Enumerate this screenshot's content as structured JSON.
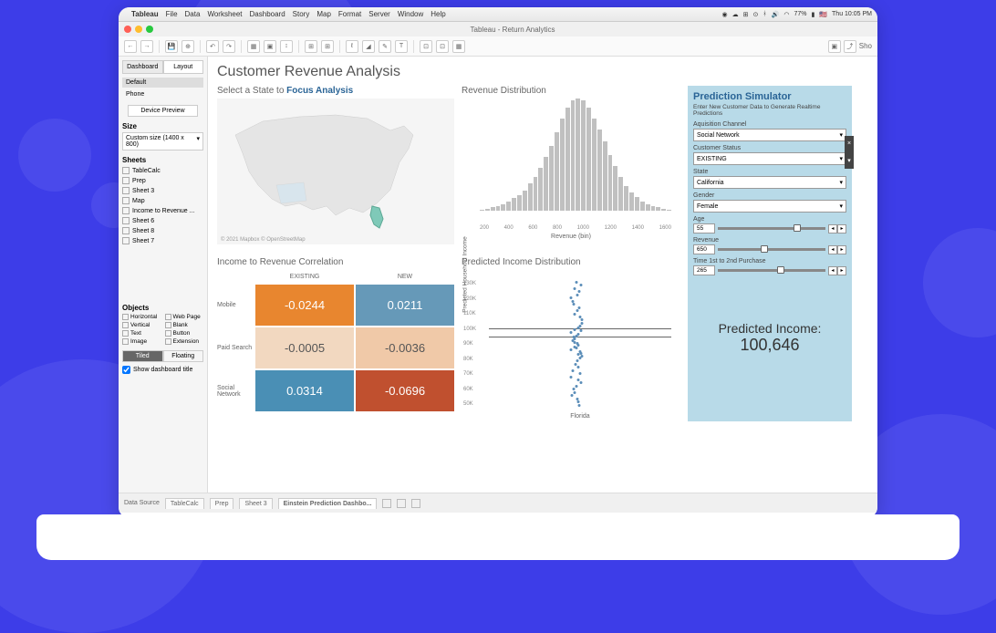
{
  "menubar": {
    "app": "Tableau",
    "items": [
      "File",
      "Data",
      "Worksheet",
      "Dashboard",
      "Story",
      "Map",
      "Format",
      "Server",
      "Window",
      "Help"
    ],
    "battery": "77%",
    "clock": "Thu 10:05 PM"
  },
  "window": {
    "title": "Tableau - Return Analytics"
  },
  "toolbar": {
    "show": "Sho"
  },
  "sidebar": {
    "tabs": [
      "Dashboard",
      "Layout"
    ],
    "devices": [
      "Default",
      "Phone"
    ],
    "device_preview": "Device Preview",
    "size_label": "Size",
    "size_value": "Custom size (1400 x 800)",
    "sheets_label": "Sheets",
    "sheets": [
      "TableCalc",
      "Prep",
      "Sheet 3",
      "Map",
      "Income to Revenue ...",
      "Sheet 6",
      "Sheet 8",
      "Sheet 7"
    ],
    "objects_label": "Objects",
    "objects": [
      "Horizontal",
      "Web Page",
      "Vertical",
      "Blank",
      "Text",
      "Button",
      "Image",
      "Extension"
    ],
    "tiled": "Tiled",
    "floating": "Floating",
    "show_title": "Show dashboard title"
  },
  "dashboard": {
    "title": "Customer Revenue Analysis",
    "map_title_a": "Select a State to ",
    "map_title_b": "Focus Analysis",
    "map_attrib": "© 2021 Mapbox © OpenStreetMap",
    "hist_title": "Revenue Distribution",
    "hist_xlabel": "Revenue (bin)",
    "corr_title": "Income to Revenue Correlation",
    "strip_title": "Predicted Income Distribution",
    "strip_ylabel": "Predicted Household Income",
    "strip_x": "Florida"
  },
  "corr": {
    "cols": [
      "EXISTING",
      "NEW"
    ],
    "rows": [
      "Mobile",
      "Paid Search",
      "Social Network"
    ],
    "cells": [
      [
        "-0.0244",
        "0.0211"
      ],
      [
        "-0.0005",
        "-0.0036"
      ],
      [
        "0.0314",
        "-0.0696"
      ]
    ],
    "colors": [
      [
        "#e8862f",
        "#6699b8"
      ],
      [
        "#f2d8c0",
        "#f0c9a8"
      ],
      [
        "#4a8fb5",
        "#c0502f"
      ]
    ]
  },
  "sim": {
    "title": "Prediction Simulator",
    "sub": "Enter New Customer Data to Generate Realtime Predictions",
    "acq_label": "Aquisition Channel",
    "acq_value": "Social Network",
    "status_label": "Customer Status",
    "status_value": "EXISTING",
    "state_label": "State",
    "state_value": "California",
    "gender_label": "Gender",
    "gender_value": "Female",
    "age_label": "Age",
    "age_value": "55",
    "revenue_label": "Revenue",
    "revenue_value": "650",
    "time_label": "Time 1st to 2nd Purchase",
    "time_value": "265",
    "result_label": "Predicted Income:",
    "result_value": "100,646"
  },
  "sheets_bar": {
    "data_source": "Data Source",
    "tabs": [
      "TableCalc",
      "Prep",
      "Sheet 3",
      "Einstein Prediction Dashbo..."
    ]
  },
  "chart_data": [
    {
      "type": "bar",
      "title": "Revenue Distribution",
      "xlabel": "Revenue (bin)",
      "xlim": [
        200,
        1600
      ],
      "x_ticks": [
        200,
        400,
        600,
        800,
        1000,
        1200,
        1400,
        1600
      ],
      "series": [
        {
          "name": "count",
          "values": [
            1,
            2,
            3,
            4,
            6,
            8,
            11,
            14,
            18,
            24,
            30,
            38,
            48,
            58,
            70,
            82,
            92,
            98,
            100,
            98,
            92,
            82,
            72,
            62,
            50,
            40,
            30,
            22,
            16,
            12,
            8,
            6,
            4,
            3,
            2,
            1
          ]
        }
      ]
    },
    {
      "type": "heatmap",
      "title": "Income to Revenue Correlation",
      "rows": [
        "Mobile",
        "Paid Search",
        "Social Network"
      ],
      "columns": [
        "EXISTING",
        "NEW"
      ],
      "values": [
        [
          -0.0244,
          0.0211
        ],
        [
          -0.0005,
          -0.0036
        ],
        [
          0.0314,
          -0.0696
        ]
      ]
    },
    {
      "type": "scatter",
      "title": "Predicted Income Distribution",
      "ylabel": "Predicted Household Income",
      "ylim": [
        50000,
        130000
      ],
      "y_ticks": [
        "130K",
        "120K",
        "110K",
        "100K",
        "90K",
        "80K",
        "70K",
        "60K",
        "50K"
      ],
      "categories": [
        "Florida"
      ],
      "reference_lines": [
        98000,
        93000
      ],
      "series": [
        {
          "name": "Florida",
          "values": [
            130000,
            128000,
            126000,
            124000,
            122000,
            120000,
            118000,
            116000,
            114000,
            112000,
            110000,
            108000,
            106000,
            104000,
            102000,
            101000,
            100000,
            99000,
            98000,
            97000,
            96000,
            95000,
            94000,
            93000,
            92000,
            91000,
            90000,
            89000,
            88000,
            87000,
            86000,
            85000,
            84000,
            83000,
            82000,
            80000,
            78000,
            76000,
            74000,
            72000,
            70000,
            68000,
            66000,
            64000,
            62000,
            60000,
            58000,
            56000,
            54000,
            52000
          ]
        }
      ]
    }
  ]
}
